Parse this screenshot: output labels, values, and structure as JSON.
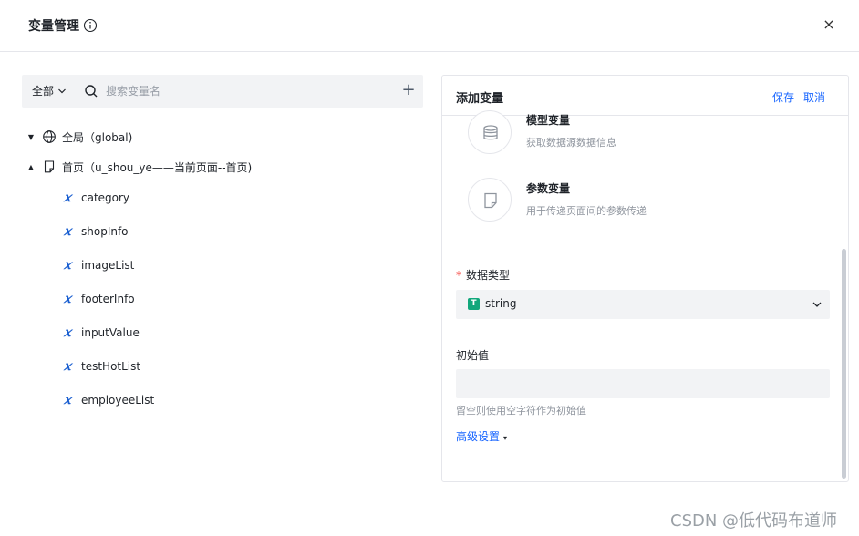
{
  "dialog": {
    "title": "变量管理",
    "info_icon": "info-icon",
    "close_icon": "close-icon",
    "close_label": "×"
  },
  "toolbar": {
    "scope": "全部",
    "search_placeholder": "搜索变量名",
    "add_label": "+"
  },
  "tree": {
    "global": {
      "label": "全局（global)",
      "icon": "globe-icon",
      "caret": "▼"
    },
    "page": {
      "label": "首页（u_shou_ye——当前页面--首页)",
      "icon": "page-icon",
      "caret": "▲"
    },
    "variables": [
      "category",
      "shopInfo",
      "imageList",
      "footerInfo",
      "inputValue",
      "testHotList",
      "employeeList"
    ],
    "variable_icon": "𝑥"
  },
  "panel": {
    "title": "添加变量",
    "save": "保存",
    "cancel": "取消",
    "types": [
      {
        "name": "模型变量",
        "desc": "获取数据源数据信息",
        "icon": "database-icon"
      },
      {
        "name": "参数变量",
        "desc": "用于传递页面间的参数传递",
        "icon": "document-icon"
      }
    ],
    "data_type_label": "数据类型",
    "required_mark": "*",
    "data_type_badge": "T",
    "data_type_value": "string",
    "initial_label": "初始值",
    "initial_value": "",
    "hint": "留空则使用空字符作为初始值",
    "advanced": "高级设置",
    "advanced_caret": "▾"
  },
  "watermark": "CSDN @低代码布道师"
}
